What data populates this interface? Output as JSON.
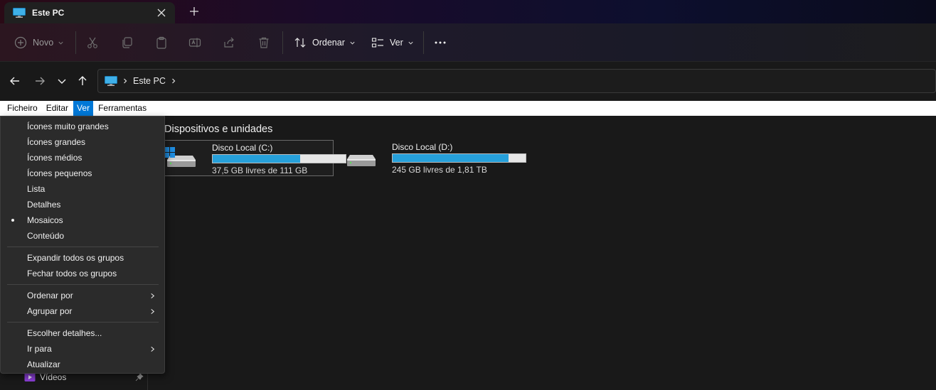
{
  "tab": {
    "title": "Este PC"
  },
  "toolbar": {
    "new_label": "Novo",
    "sort_label": "Ordenar",
    "view_label": "Ver"
  },
  "address": {
    "crumb": "Este PC"
  },
  "menubar": {
    "items": [
      "Ficheiro",
      "Editar",
      "Ver",
      "Ferramentas"
    ],
    "active": "Ver"
  },
  "content": {
    "group_title": "Dispositivos e unidades",
    "drives": [
      {
        "name": "Disco Local (C:)",
        "free": "37,5 GB livres de 111 GB",
        "used_fraction": 0.66
      },
      {
        "name": "Disco Local (D:)",
        "free": "245 GB livres de 1,81 TB",
        "used_fraction": 0.87
      }
    ]
  },
  "sidebar": {
    "visible_item": "Vídeos"
  },
  "view_menu": {
    "layout_items": [
      "Ícones muito grandes",
      "Ícones grandes",
      "Ícones médios",
      "Ícones pequenos",
      "Lista",
      "Detalhes",
      "Mosaicos",
      "Conteúdo"
    ],
    "selected_layout": "Mosaicos",
    "group_items": [
      "Expandir todos os grupos",
      "Fechar todos os grupos"
    ],
    "submenu_items": [
      "Ordenar por",
      "Agrupar por"
    ],
    "other_items": [
      "Escolher detalhes...",
      "Ir para",
      "Atualizar"
    ]
  },
  "colors": {
    "accent": "#0078d7",
    "bar_fill": "#26a0da"
  }
}
